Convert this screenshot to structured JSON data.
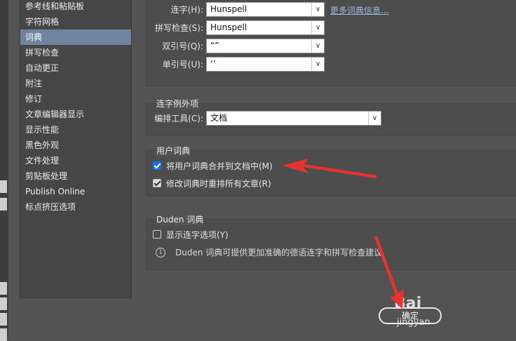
{
  "sidebar": {
    "items": [
      {
        "label": "参考线和粘贴板"
      },
      {
        "label": "字符网格"
      },
      {
        "label": "词典"
      },
      {
        "label": "拼写检查"
      },
      {
        "label": "自动更正"
      },
      {
        "label": "附注"
      },
      {
        "label": "修订"
      },
      {
        "label": "文章编辑器显示"
      },
      {
        "label": "显示性能"
      },
      {
        "label": "黑色外观"
      },
      {
        "label": "文件处理"
      },
      {
        "label": "剪贴板处理"
      },
      {
        "label": "Publish Online"
      },
      {
        "label": "标点挤压选项"
      }
    ],
    "selected_index": 2
  },
  "language": {
    "hyphenation_label": "连字(H):",
    "hyphenation_value": "Hunspell",
    "more_dictionaries_link": "更多词典信息...",
    "spelling_label": "拼写检查(S):",
    "spelling_value": "Hunspell",
    "double_quotes_label": "双引号(Q):",
    "double_quotes_value": "“”",
    "single_quotes_label": "单引号(U):",
    "single_quotes_value": "‘’"
  },
  "hyphenation_exceptions": {
    "title": "连字例外项",
    "compose_using_label": "编排工具(C):",
    "compose_using_value": "文档"
  },
  "user_dictionary": {
    "title": "用户词典",
    "merge_label": "将用户词典合并到文档中(M)",
    "merge_checked": true,
    "recompose_label": "修改词典时重排所有文章(R)",
    "recompose_checked": true
  },
  "duden": {
    "title": "Duden 词典",
    "show_options_label": "显示连字选项(Y)",
    "show_options_checked": false,
    "info_text": "Duden 词典可提供更加准确的德语连字和拼写检查建议"
  },
  "footer": {
    "ok_label": "确定"
  },
  "watermark": {
    "brand": "Bai",
    "site": "jingyan"
  },
  "colors": {
    "selection": "#6e849f",
    "annotation_arrow": "#e8322e",
    "checkbox_accent": "#1473e6"
  },
  "icons": {
    "dropdown": "chevron-down-icon",
    "info": "info-icon"
  }
}
